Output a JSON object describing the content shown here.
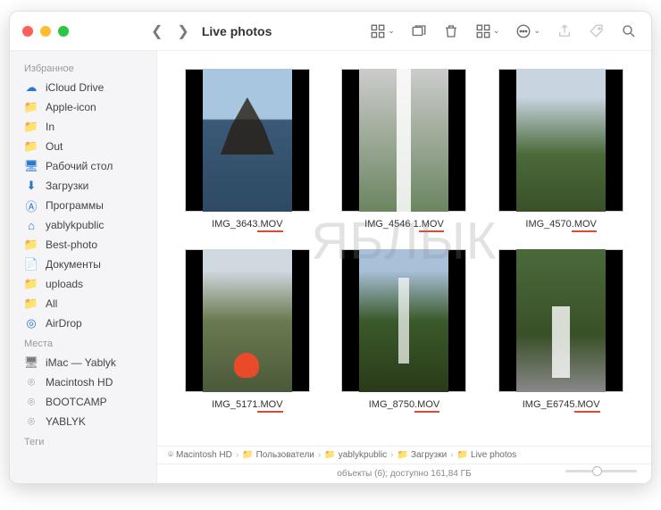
{
  "header": {
    "title": "Live photos"
  },
  "sidebar": {
    "sections": [
      {
        "label": "Избранное",
        "items": [
          {
            "icon": "cloud",
            "label": "iCloud Drive"
          },
          {
            "icon": "folder",
            "label": "Apple-icon"
          },
          {
            "icon": "folder",
            "label": "In"
          },
          {
            "icon": "folder",
            "label": "Out"
          },
          {
            "icon": "desktop",
            "label": "Рабочий стол"
          },
          {
            "icon": "download",
            "label": "Загрузки"
          },
          {
            "icon": "apps",
            "label": "Программы"
          },
          {
            "icon": "home",
            "label": "yablykpublic"
          },
          {
            "icon": "folder",
            "label": "Best-photo"
          },
          {
            "icon": "doc",
            "label": "Документы"
          },
          {
            "icon": "folder",
            "label": "uploads"
          },
          {
            "icon": "folder",
            "label": "All"
          },
          {
            "icon": "airdrop",
            "label": "AirDrop"
          }
        ]
      },
      {
        "label": "Места",
        "items": [
          {
            "icon": "monitor",
            "label": "iMac — Yablyk"
          },
          {
            "icon": "disk",
            "label": "Macintosh HD"
          },
          {
            "icon": "disk",
            "label": "BOOTCAMP"
          },
          {
            "icon": "disk",
            "label": "YABLYK"
          }
        ]
      },
      {
        "label": "Теги",
        "items": []
      }
    ]
  },
  "files": [
    {
      "name": "IMG_3643",
      "ext": ".MOV",
      "thumb": "ship"
    },
    {
      "name": "IMG_4546 1",
      "ext": ".MOV",
      "thumb": "wf1"
    },
    {
      "name": "IMG_4570",
      "ext": ".MOV",
      "thumb": "mtn"
    },
    {
      "name": "IMG_5171",
      "ext": ".MOV",
      "thumb": "gorge"
    },
    {
      "name": "IMG_8750",
      "ext": ".MOV",
      "thumb": "wf2"
    },
    {
      "name": "IMG_E6745",
      "ext": ".MOV",
      "thumb": "wf3"
    }
  ],
  "pathbar": [
    "Macintosh HD",
    "Пользователи",
    "yablykpublic",
    "Загрузки",
    "Live photos"
  ],
  "status": "объекты (6); доступно 161,84 ГБ",
  "watermark": "ЯБЛЫК"
}
